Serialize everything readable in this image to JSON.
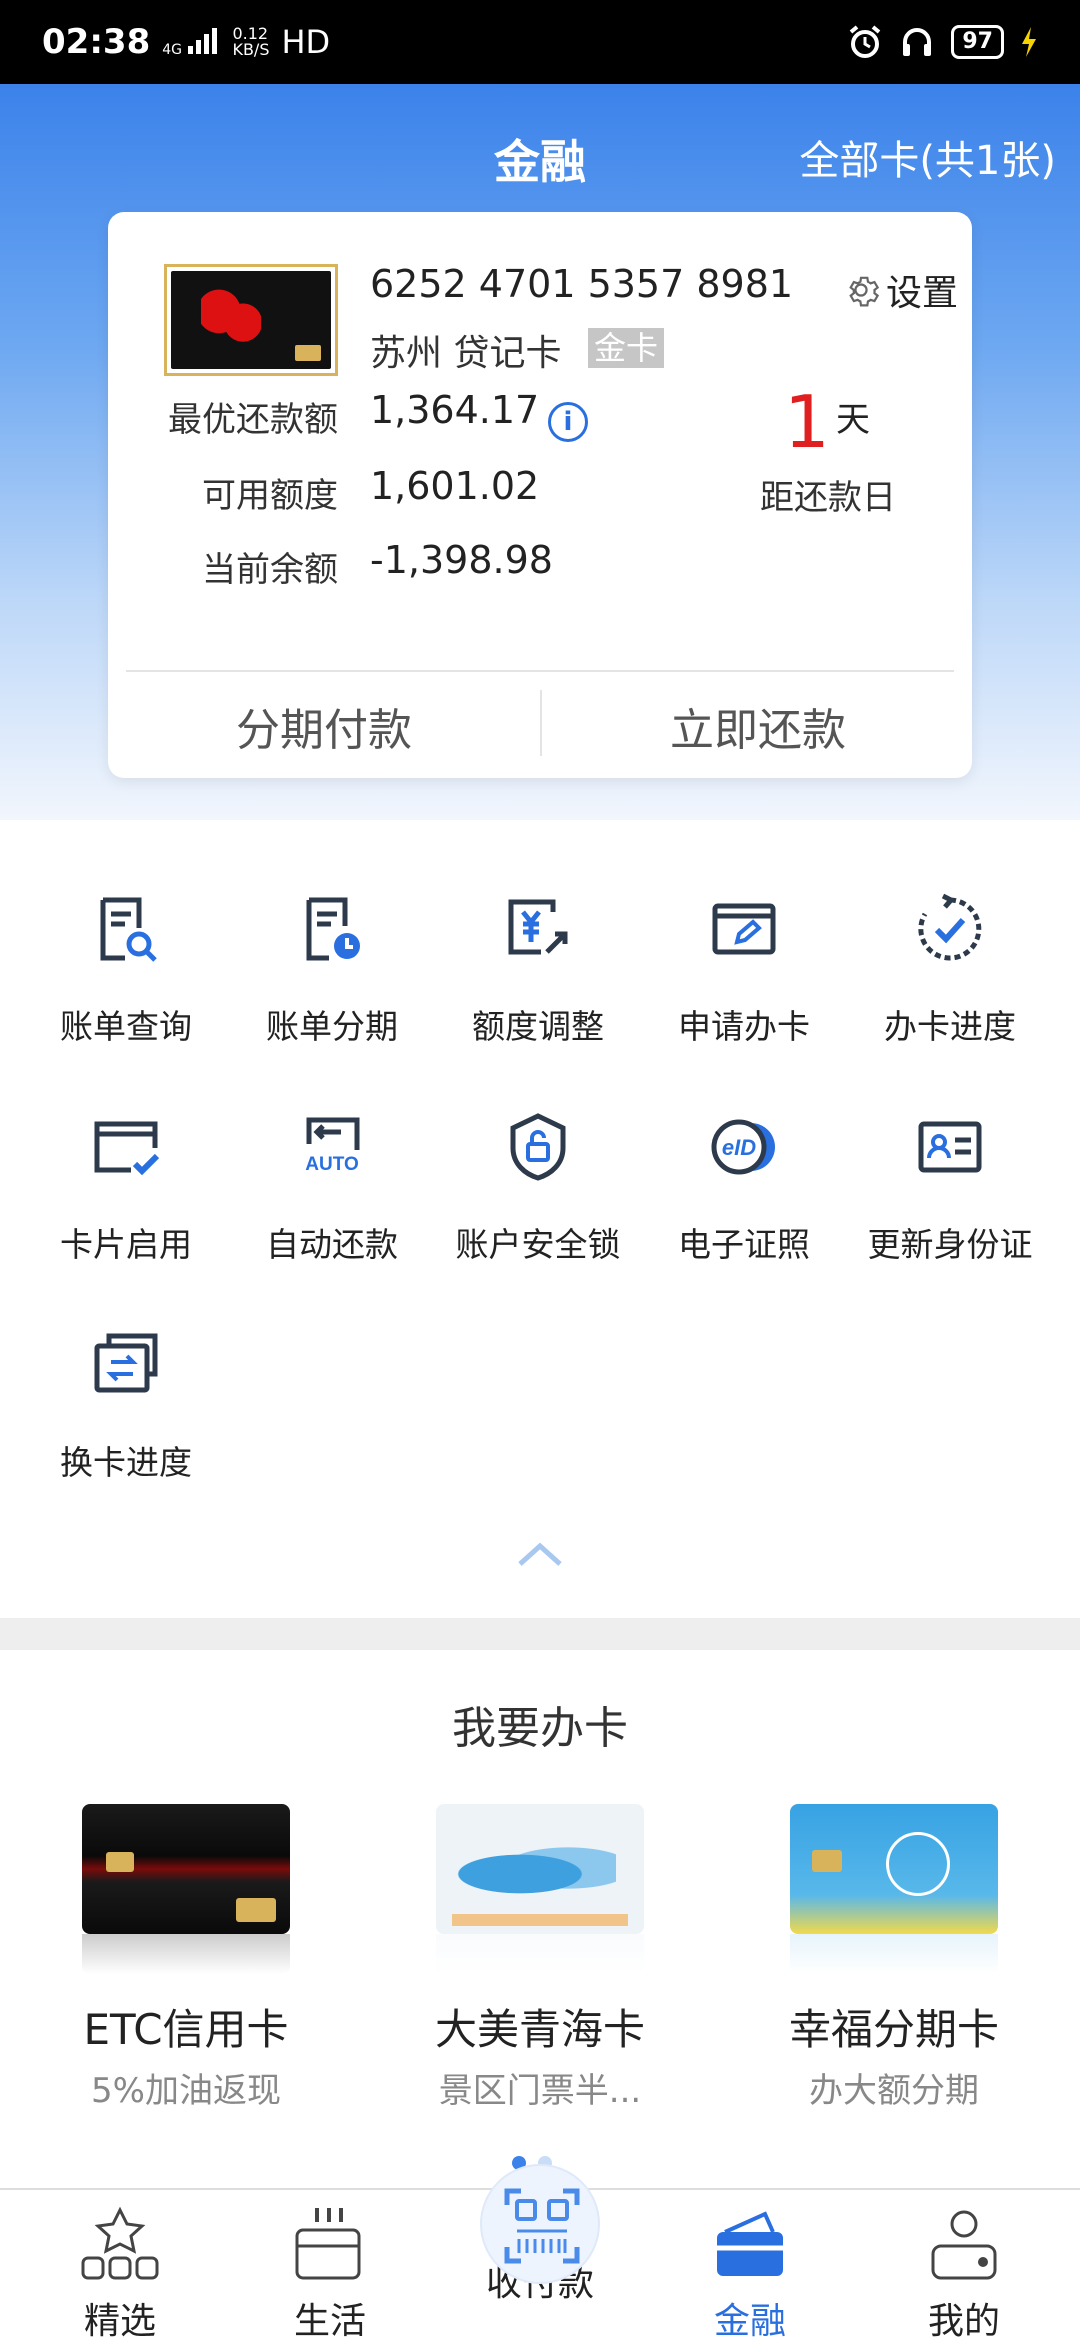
{
  "status_bar": {
    "time": "02:38",
    "network": "4G",
    "speed_value": "0.12",
    "speed_unit": "KB/S",
    "hd": "HD",
    "battery": "97"
  },
  "header": {
    "title": "金融",
    "all_cards": "全部卡(共1张)"
  },
  "card": {
    "number": "6252 4701 5357 8981",
    "bank": "苏州 贷记卡",
    "badge": "金卡",
    "settings": "设置",
    "rows": [
      {
        "label": "最优还款额",
        "value": "1,364.17"
      },
      {
        "label": "可用额度",
        "value": "1,601.02"
      },
      {
        "label": "当前余额",
        "value": "-1,398.98"
      }
    ],
    "days_number": "1",
    "days_unit": "天",
    "days_label": "距还款日",
    "btn_installment": "分期付款",
    "btn_repay": "立即还款",
    "info_icon": "i"
  },
  "grid": [
    {
      "label": "账单查询",
      "icon": "bill-search-icon"
    },
    {
      "label": "账单分期",
      "icon": "bill-installment-icon"
    },
    {
      "label": "额度调整",
      "icon": "credit-limit-icon"
    },
    {
      "label": "申请办卡",
      "icon": "apply-card-icon"
    },
    {
      "label": "办卡进度",
      "icon": "card-progress-icon"
    },
    {
      "label": "卡片启用",
      "icon": "card-activate-icon"
    },
    {
      "label": "自动还款",
      "icon": "auto-repay-icon"
    },
    {
      "label": "账户安全锁",
      "icon": "security-lock-icon"
    },
    {
      "label": "电子证照",
      "icon": "eid-icon"
    },
    {
      "label": "更新身份证",
      "icon": "id-card-icon"
    },
    {
      "label": "换卡进度",
      "icon": "card-exchange-icon"
    }
  ],
  "grid_auto_text": "AUTO",
  "grid_eid_text": "eID",
  "apply": {
    "title": "我要办卡",
    "cards": [
      {
        "name": "ETC信用卡",
        "desc": "5%加油返现"
      },
      {
        "name": "大美青海卡",
        "desc": "景区门票半..."
      },
      {
        "name": "幸福分期卡",
        "desc": "办大额分期"
      }
    ]
  },
  "nav": [
    {
      "label": "精选"
    },
    {
      "label": "生活"
    },
    {
      "label": "收付款"
    },
    {
      "label": "金融"
    },
    {
      "label": "我的"
    }
  ],
  "colors": {
    "accent": "#2a6fe0",
    "icon_dark": "#2c3a4b",
    "red": "#e02020"
  }
}
